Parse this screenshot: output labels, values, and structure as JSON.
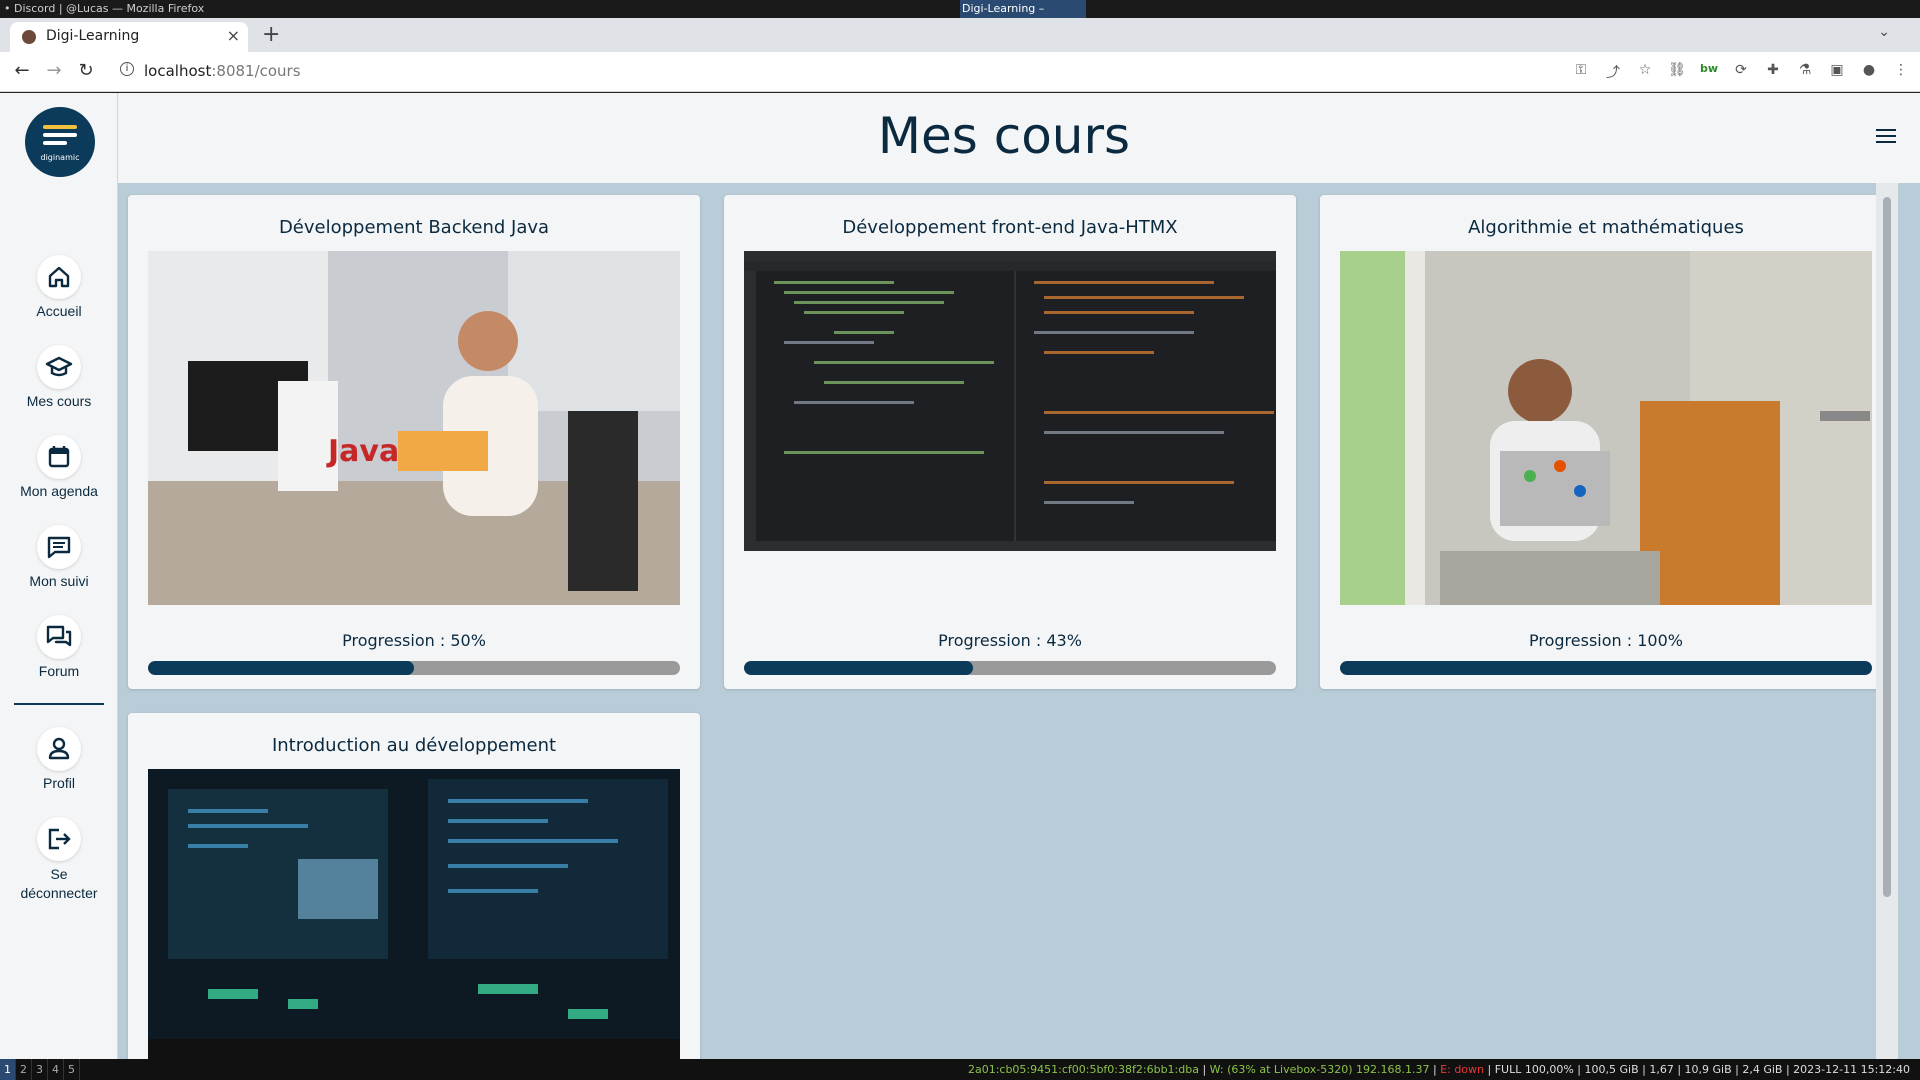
{
  "system": {
    "left_title": "• Discord | @Lucas — Mozilla Firefox",
    "center_title": "Digi-Learning – Chromium"
  },
  "browser": {
    "tab_title": "Digi-Learning",
    "url_host": "localhost",
    "url_path": ":8081/cours"
  },
  "app": {
    "logo_text": "diginamic",
    "page_title": "Mes cours",
    "nav": [
      {
        "label": "Accueil"
      },
      {
        "label": "Mes cours"
      },
      {
        "label": "Mon agenda"
      },
      {
        "label": "Mon suivi"
      },
      {
        "label": "Forum"
      },
      {
        "label": "Profil"
      },
      {
        "label": "Se déconnecter"
      }
    ],
    "courses": [
      {
        "title": "Développement Backend Java",
        "progress_text": "Progression : 50%",
        "progress": 0.5
      },
      {
        "title": "Développement front-end Java-HTMX",
        "progress_text": "Progression : 43%",
        "progress": 0.43
      },
      {
        "title": "Algorithmie et mathématiques",
        "progress_text": "Progression : 100%",
        "progress": 1.0
      },
      {
        "title": "Introduction au développement",
        "progress_text": "",
        "progress": 0
      }
    ]
  },
  "statusbar": {
    "workspaces": [
      "1",
      "2",
      "3",
      "4",
      "5"
    ],
    "ip": "2a01:cb05:9451:cf00:5bf0:38f2:6bb1:dba",
    "wifi": "W: (63% at Livebox-5320) 192.168.1.37",
    "eth": "E: down",
    "battery": "FULL 100,00%",
    "disk": "100,5 GiB",
    "load": "1,67",
    "mem": "10,9 GiB | 2,4 GiB",
    "datetime": "2023-12-11 15:12:40"
  }
}
